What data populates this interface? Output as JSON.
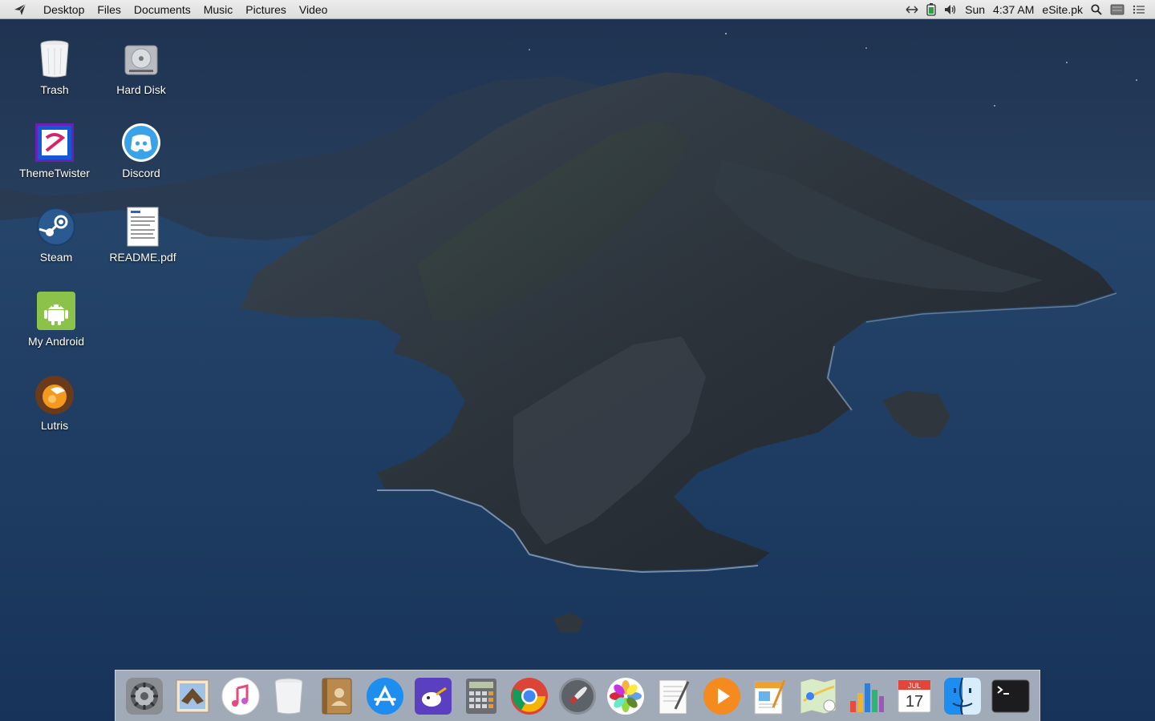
{
  "menubar": {
    "items": [
      "Desktop",
      "Files",
      "Documents",
      "Music",
      "Pictures",
      "Video"
    ],
    "tray": {
      "day": "Sun",
      "time": "4:37 AM",
      "site": "eSite.pk"
    }
  },
  "desktop_icons": [
    {
      "label": "Trash",
      "icon": "trash-icon"
    },
    {
      "label": "Hard Disk",
      "icon": "hard-disk-icon"
    },
    {
      "label": "ThemeTwister",
      "icon": "themetwister-icon"
    },
    {
      "label": "Discord",
      "icon": "discord-icon"
    },
    {
      "label": "Steam",
      "icon": "steam-icon"
    },
    {
      "label": "README.pdf",
      "icon": "pdf-document-icon"
    },
    {
      "label": "My Android",
      "icon": "android-icon"
    },
    {
      "label": "Lutris",
      "icon": "lutris-icon"
    }
  ],
  "dock_apps": [
    "system-preferences-icon",
    "mail-icon",
    "music-icon",
    "trash-icon",
    "contacts-icon",
    "app-store-icon",
    "gimp-icon",
    "calculator-icon",
    "chrome-icon",
    "launchpad-icon",
    "photos-icon",
    "text-editor-icon",
    "media-player-icon",
    "pages-icon",
    "maps-icon",
    "numbers-icon",
    "calendar-icon",
    "finder-icon",
    "terminal-icon"
  ],
  "calendar": {
    "month": "JUL",
    "day": "17"
  },
  "colors": {
    "menubar": "#e6e6e6",
    "ocean": "#1d3a5e",
    "dock": "#c8cdd4"
  }
}
